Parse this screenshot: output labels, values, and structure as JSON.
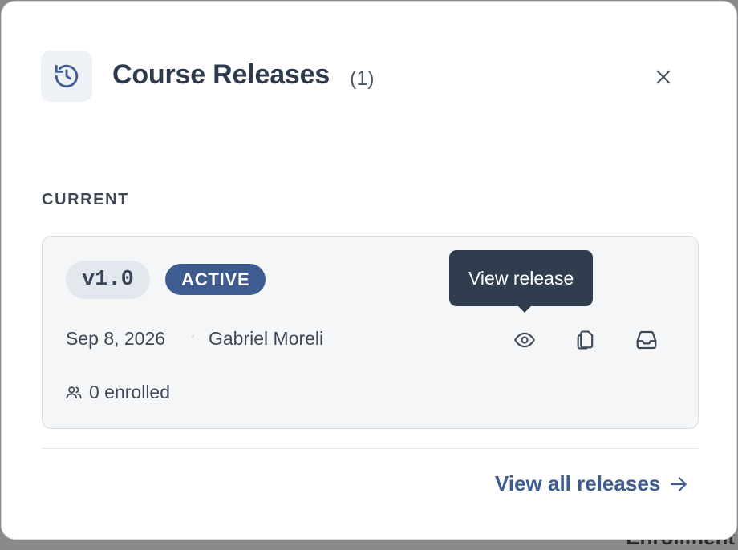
{
  "backdrop": {
    "peek_text": "Enrollment"
  },
  "header": {
    "icon": "history-icon",
    "title": "Course Releases",
    "count": "(1)",
    "close_icon": "close-icon"
  },
  "section": {
    "label": "CURRENT"
  },
  "release": {
    "version": "v1.0",
    "status": "ACTIVE",
    "date": "Sep 8, 2026",
    "separator": "·",
    "author": "Gabriel Moreli",
    "enrolled": "0 enrolled",
    "enrolled_icon": "users-icon",
    "actions": [
      {
        "name": "view",
        "icon": "eye-icon",
        "tooltip": "View release"
      },
      {
        "name": "duplicate",
        "icon": "copy-icon"
      },
      {
        "name": "archive",
        "icon": "inbox-icon"
      }
    ]
  },
  "tooltip": {
    "text": "View release"
  },
  "footer": {
    "link_label": "View all releases",
    "link_icon": "arrow-right-icon"
  },
  "colors": {
    "accent": "#3e5c90",
    "title": "#2e3a4b",
    "card_bg": "#f4f6f8",
    "tooltip_bg": "#2f3d4f"
  }
}
